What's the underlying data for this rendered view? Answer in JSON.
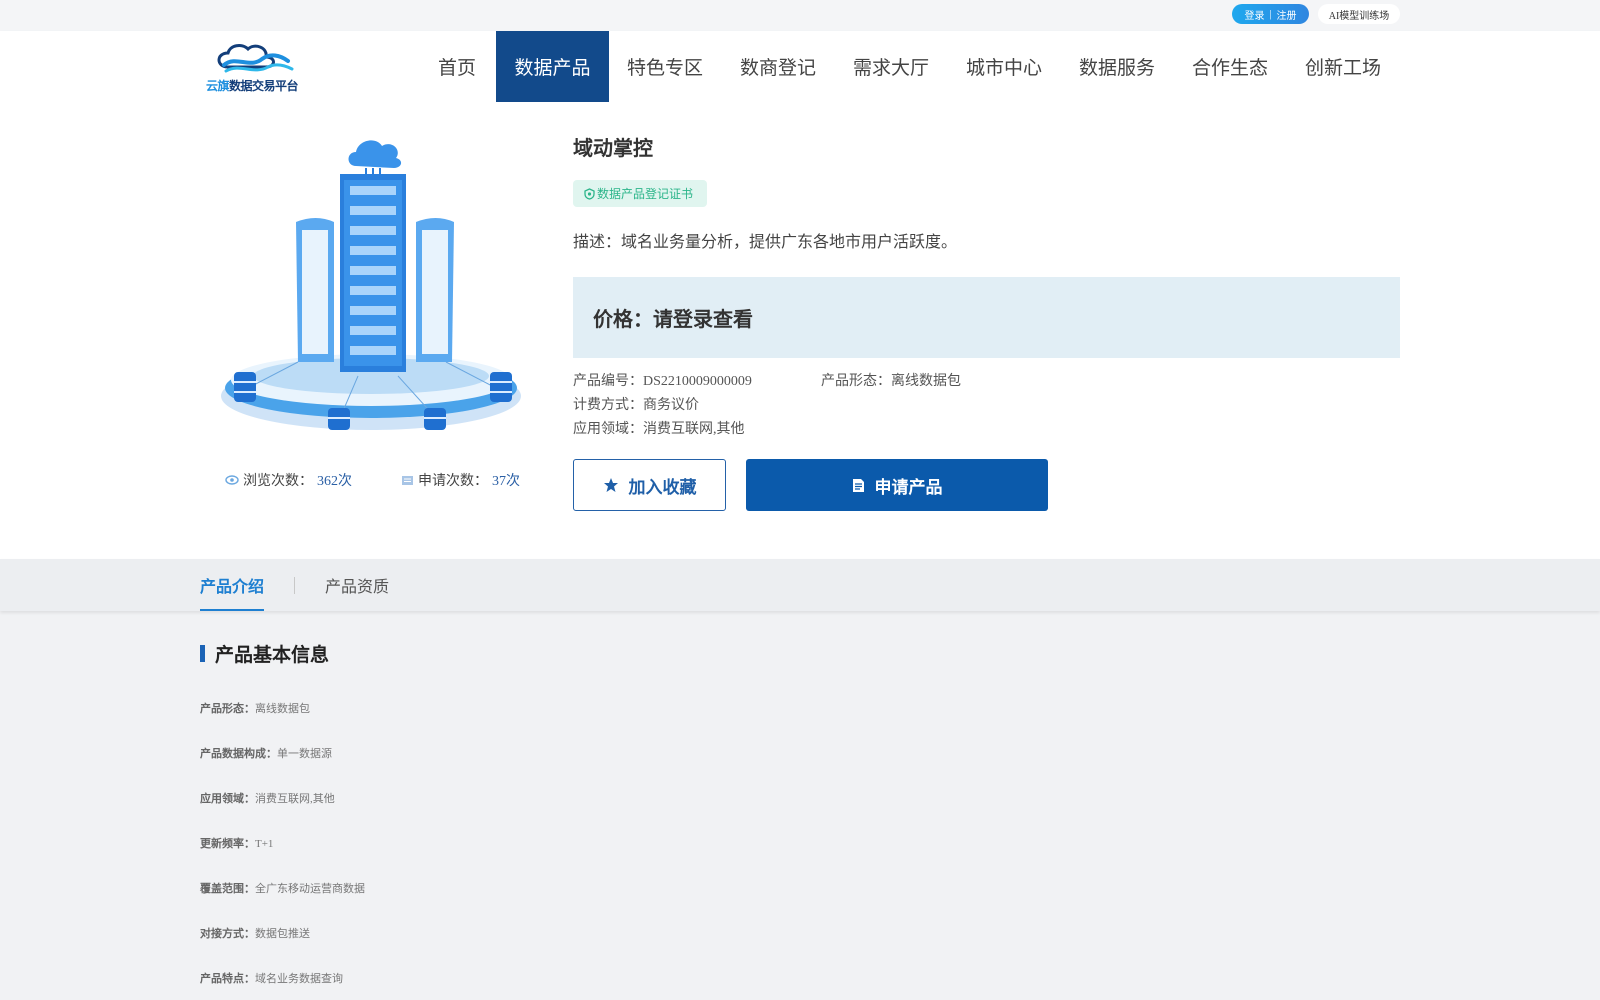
{
  "topbar": {
    "login": "登录",
    "separator": "|",
    "register": "注册",
    "ai": "AI模型训练场"
  },
  "logo": {
    "brand_part1": "云旗",
    "brand_part2": "数据交易平台"
  },
  "nav": {
    "items": [
      {
        "label": "首页"
      },
      {
        "label": "数据产品"
      },
      {
        "label": "特色专区"
      },
      {
        "label": "数商登记"
      },
      {
        "label": "需求大厅"
      },
      {
        "label": "城市中心"
      },
      {
        "label": "数据服务"
      },
      {
        "label": "合作生态"
      },
      {
        "label": "创新工场"
      }
    ],
    "active_index": 1
  },
  "product": {
    "title": "域动掌控",
    "cert_label": "数据产品登记证书",
    "description": "描述：域名业务量分析，提供广东各地市用户活跃度。",
    "price": "价格：请登录查看",
    "views_label": "浏览次数：",
    "views_value": "362次",
    "apply_count_label": "申请次数：",
    "apply_count_value": "37次",
    "meta": {
      "code": "产品编号：DS2210009000009",
      "form": "产品形态：离线数据包",
      "billing": "计费方式：商务议价",
      "domain": "应用领域：消费互联网,其他"
    },
    "favorite_button": "加入收藏",
    "apply_button": "申请产品"
  },
  "tabs": {
    "intro": "产品介绍",
    "qualification": "产品资质"
  },
  "info": {
    "heading": "产品基本信息",
    "rows": [
      {
        "key": "产品形态：",
        "value": "离线数据包"
      },
      {
        "key": "产品数据构成：",
        "value": "单一数据源"
      },
      {
        "key": "应用领域：",
        "value": "消费互联网,其他"
      },
      {
        "key": "更新频率：",
        "value": "T+1"
      },
      {
        "key": "覆盖范围：",
        "value": "全广东移动运营商数据"
      },
      {
        "key": "对接方式：",
        "value": "数据包推送"
      },
      {
        "key": "产品特点：",
        "value": "域名业务数据查询"
      }
    ]
  },
  "colors": {
    "primary": "#0b5aab",
    "nav_active": "#124a8b",
    "accent": "#1e7fd1",
    "cert": "#2cb58a"
  },
  "icons": {
    "views": "eye-icon",
    "apply_count": "document-icon",
    "favorite": "star-icon",
    "apply": "file-icon",
    "cert": "shield-icon"
  }
}
